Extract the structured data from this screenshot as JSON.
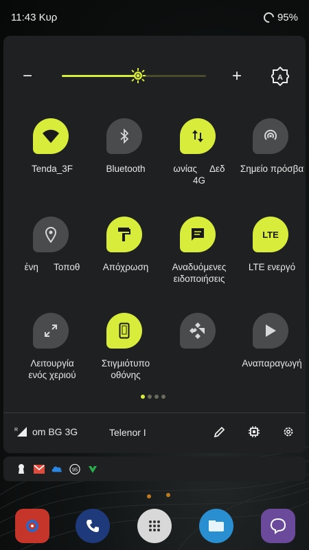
{
  "status_bar": {
    "time": "11:43 Κυρ",
    "battery": "95%"
  },
  "brightness": {
    "minus_label": "−",
    "plus_label": "+",
    "level": 0.53
  },
  "tiles": [
    {
      "label": "Tenda_3F",
      "label2": "",
      "icon": "wifi-icon",
      "state": "on"
    },
    {
      "label": "Bluetooth",
      "label2": "",
      "icon": "bluetooth-icon",
      "state": "off"
    },
    {
      "label": "ωνίας     Δεδ",
      "label2": "4G",
      "icon": "mobile-data-icon",
      "state": "on"
    },
    {
      "label": "Σημείο πρόσβα",
      "label2": "",
      "icon": "hotspot-icon",
      "state": "off"
    },
    {
      "label": "ένη      Τοποθ",
      "label2": "",
      "icon": "location-icon",
      "state": "off"
    },
    {
      "label": "Απόχρωση",
      "label2": "",
      "icon": "paint-roller-icon",
      "state": "on"
    },
    {
      "label": "Αναδυόμενες",
      "label2": "ειδοποιήσεις",
      "icon": "message-icon",
      "state": "on"
    },
    {
      "label": "LTE ενεργό",
      "label2": "",
      "icon": "lte-icon",
      "state": "on"
    },
    {
      "label": "Λειτουργία",
      "label2": "ενός χεριού",
      "icon": "one-hand-icon",
      "state": "off"
    },
    {
      "label": "Στιγμιότυπο",
      "label2": "οθόνης",
      "icon": "screenshot-icon",
      "state": "on"
    },
    {
      "label": "",
      "label2": "",
      "icon": "kodi-icon",
      "state": "off"
    },
    {
      "label": "Αναπαραγωγή",
      "label2": "",
      "icon": "play-icon",
      "state": "off"
    }
  ],
  "lte_text": "LTE",
  "footer": {
    "carrier1": "om BG 3G",
    "carrier1_prefix": "R",
    "carrier2": "Telenor I"
  },
  "colors": {
    "accent": "#d8ec3c",
    "panel": "#1f2022",
    "tile_off": "#4a4b4d"
  },
  "notification_icons": [
    "keyhole-icon",
    "gmail-icon",
    "onedrive-icon",
    "badge-95-icon",
    "feedly-icon"
  ],
  "notif_badge": "95",
  "dock_icons": [
    "app-red-icon",
    "phone-icon",
    "app-drawer-icon",
    "es-explorer-icon",
    "viber-icon"
  ]
}
